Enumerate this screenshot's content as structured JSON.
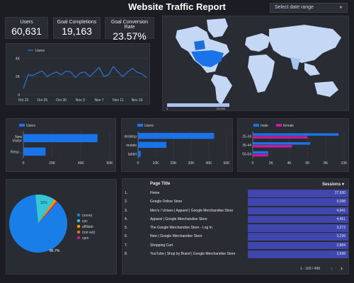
{
  "header": {
    "title": "Website Traffic Report",
    "date_range_label": "Select date range"
  },
  "kpis": [
    {
      "label": "Users",
      "value": "60,631"
    },
    {
      "label": "Goal Completions",
      "value": "19,163"
    },
    {
      "label": "Goal Conversion Rate",
      "value": "23.57%"
    }
  ],
  "colors": {
    "background": "#1b1d23",
    "card": "#292c33",
    "blue": "#1a73e8",
    "magenta": "#c21d9c",
    "line": "#2b74d6",
    "pie_main": "#1a7ee8",
    "pie_secondary": "#36c6d6",
    "sessions_bar": "#3f46ad",
    "land": "#c4d7f4"
  },
  "map": {
    "scale_labels": [
      "1",
      "25,000"
    ]
  },
  "line_chart": {
    "legend": "Users",
    "x_labels": [
      "Oct 22",
      "Oct 26",
      "Oct 30",
      "Nov 3",
      "Nov 7",
      "Nov 11",
      "Nov 15"
    ],
    "y_labels": [
      "0",
      "2K",
      "4K"
    ]
  },
  "user_type_chart": {
    "legend": "Users",
    "categories": [
      "New Visitor",
      "Retur..."
    ],
    "x_labels": [
      "0",
      "20K",
      "40K",
      "60K"
    ]
  },
  "device_chart": {
    "legend": "Users",
    "categories": [
      "desktop",
      "mobile",
      "tablet"
    ],
    "x_labels": [
      "0",
      "10K",
      "20K",
      "30K",
      "40K",
      "50K"
    ]
  },
  "age_chart": {
    "legend": [
      "male",
      "female"
    ],
    "categories": [
      "25-34",
      "35-44",
      "55-64"
    ],
    "x_labels": [
      "0",
      "2K",
      "4K",
      "6K",
      "8K",
      "10K"
    ]
  },
  "pie_chart": {
    "legend": [
      "(none)",
      "cpc",
      "affiliate",
      "(not set)",
      "cpm"
    ],
    "legend_colors": [
      "#1a7ee8",
      "#36c6d6",
      "#ff9800",
      "#e8710a",
      "#c21d9c"
    ],
    "pct_labels": [
      "11%",
      "86.7%"
    ]
  },
  "chart_data": [
    {
      "type": "line",
      "title": "",
      "xlabel": "",
      "ylabel": "",
      "x": [
        "Oct 22",
        "Oct 23",
        "Oct 24",
        "Oct 25",
        "Oct 26",
        "Oct 27",
        "Oct 28",
        "Oct 29",
        "Oct 30",
        "Oct 31",
        "Nov 1",
        "Nov 2",
        "Nov 3",
        "Nov 4",
        "Nov 5",
        "Nov 6",
        "Nov 7",
        "Nov 8",
        "Nov 9",
        "Nov 10",
        "Nov 11",
        "Nov 12",
        "Nov 13",
        "Nov 14",
        "Nov 15",
        "Nov 16",
        "Nov 17"
      ],
      "series": [
        {
          "name": "Users",
          "values": [
            700,
            2200,
            2100,
            2400,
            2600,
            2000,
            2300,
            2500,
            2200,
            2600,
            2500,
            1900,
            2400,
            2500,
            2000,
            2500,
            3000,
            2000,
            2200,
            3100,
            2500,
            2000,
            2500,
            2900,
            2500,
            2300,
            1900
          ]
        }
      ],
      "ylim": [
        0,
        4500
      ]
    },
    {
      "type": "bar",
      "orientation": "horizontal",
      "categories": [
        "New Visitor",
        "Retur..."
      ],
      "series": [
        {
          "name": "Users",
          "values": [
            51500,
            15500
          ]
        }
      ],
      "xlim": [
        0,
        60000
      ]
    },
    {
      "type": "bar",
      "orientation": "horizontal",
      "categories": [
        "desktop",
        "mobile",
        "tablet"
      ],
      "series": [
        {
          "name": "Users",
          "values": [
            43000,
            16000,
            1500
          ]
        }
      ],
      "xlim": [
        0,
        50000
      ]
    },
    {
      "type": "bar",
      "orientation": "horizontal",
      "categories": [
        "25-34",
        "35-44",
        "55-64"
      ],
      "series": [
        {
          "name": "male",
          "values": [
            9400,
            6300,
            1700
          ]
        },
        {
          "name": "female",
          "values": [
            6000,
            4300,
            1700
          ]
        }
      ],
      "xlim": [
        0,
        10000
      ]
    },
    {
      "type": "pie",
      "categories": [
        "(none)",
        "cpc",
        "affiliate",
        "(not set)",
        "cpm"
      ],
      "values": [
        86.7,
        11.0,
        1.2,
        0.6,
        0.5
      ]
    }
  ],
  "table": {
    "headers": {
      "page_title": "Page Title",
      "sessions": "Sessions"
    },
    "sort_icon": "sort-desc-icon",
    "rows": [
      {
        "num": "1.",
        "page": "Home",
        "sessions": "27,930",
        "frac": 1.0
      },
      {
        "num": "2.",
        "page": "Google Online Store",
        "sessions": "9,098",
        "frac": 0.326
      },
      {
        "num": "3.",
        "page": "Men's / Unisex | Apparel | Google Merchandise Store",
        "sessions": "4,941",
        "frac": 0.177
      },
      {
        "num": "4.",
        "page": "Apparel | Google Merchandise Store",
        "sessions": "4,461",
        "frac": 0.16
      },
      {
        "num": "5.",
        "page": "The Google Merchandise Store - Log In",
        "sessions": "3,272",
        "frac": 0.117
      },
      {
        "num": "6.",
        "page": "New | Google Merchandise Store",
        "sessions": "3,236",
        "frac": 0.116
      },
      {
        "num": "7.",
        "page": "Shopping Cart",
        "sessions": "2,884",
        "frac": 0.103
      },
      {
        "num": "8.",
        "page": "YouTube | Shop by Brand | Google Merchandise Store",
        "sessions": "2,698",
        "frac": 0.097
      }
    ],
    "pagination": "1 - 100 / 498"
  }
}
